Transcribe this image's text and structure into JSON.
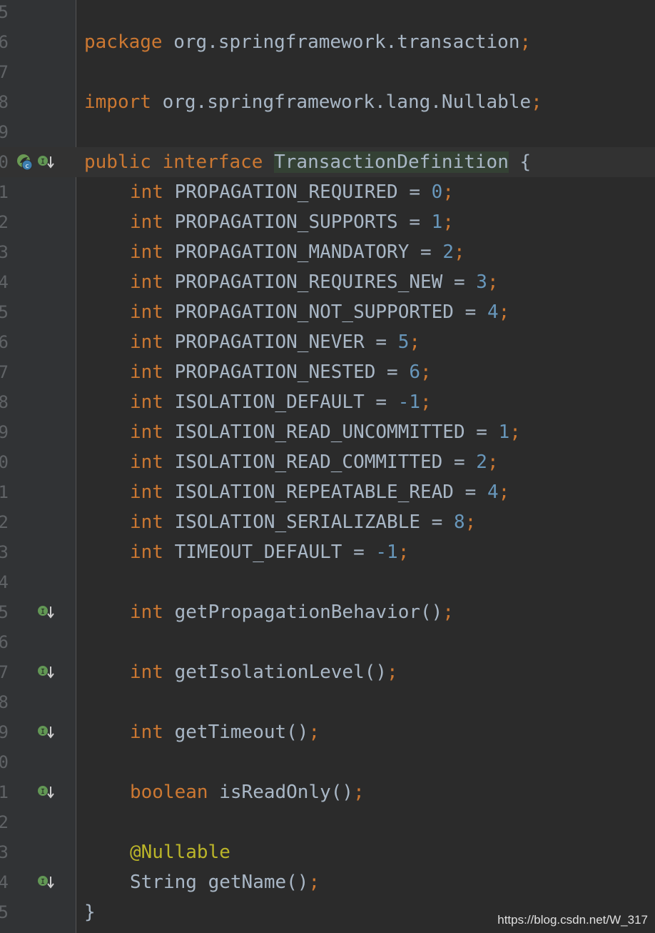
{
  "editor": {
    "gutter_line_numbers": [
      "5",
      "6",
      "7",
      "8",
      "9",
      "0",
      "1",
      "2",
      "3",
      "4",
      "5",
      "6",
      "7",
      "8",
      "9",
      "0",
      "1",
      "2",
      "3",
      "4",
      "5",
      "6",
      "7",
      "8",
      "9",
      "0",
      "1",
      "2",
      "3",
      "4",
      "5"
    ],
    "package_kw": "package",
    "package_name": "org.springframework.transaction",
    "import_kw": "import",
    "import_name": "org.springframework.lang.Nullable",
    "public_kw": "public",
    "interface_kw": "interface",
    "interface_name": "TransactionDefinition",
    "open_brace": "{",
    "close_brace": "}",
    "constants": [
      {
        "type": "int",
        "name": "PROPAGATION_REQUIRED",
        "value": "0"
      },
      {
        "type": "int",
        "name": "PROPAGATION_SUPPORTS",
        "value": "1"
      },
      {
        "type": "int",
        "name": "PROPAGATION_MANDATORY",
        "value": "2"
      },
      {
        "type": "int",
        "name": "PROPAGATION_REQUIRES_NEW",
        "value": "3"
      },
      {
        "type": "int",
        "name": "PROPAGATION_NOT_SUPPORTED",
        "value": "4"
      },
      {
        "type": "int",
        "name": "PROPAGATION_NEVER",
        "value": "5"
      },
      {
        "type": "int",
        "name": "PROPAGATION_NESTED",
        "value": "6"
      },
      {
        "type": "int",
        "name": "ISOLATION_DEFAULT",
        "value": "-1"
      },
      {
        "type": "int",
        "name": "ISOLATION_READ_UNCOMMITTED",
        "value": "1"
      },
      {
        "type": "int",
        "name": "ISOLATION_READ_COMMITTED",
        "value": "2"
      },
      {
        "type": "int",
        "name": "ISOLATION_REPEATABLE_READ",
        "value": "4"
      },
      {
        "type": "int",
        "name": "ISOLATION_SERIALIZABLE",
        "value": "8"
      },
      {
        "type": "int",
        "name": "TIMEOUT_DEFAULT",
        "value": "-1"
      }
    ],
    "methods": [
      {
        "type": "int",
        "name": "getPropagationBehavior();"
      },
      {
        "type": "int",
        "name": "getIsolationLevel();"
      },
      {
        "type": "int",
        "name": "getTimeout();"
      },
      {
        "type": "boolean",
        "name": "isReadOnly();"
      }
    ],
    "annotation": "@Nullable",
    "last_method_type": "String",
    "last_method_name": "getName();",
    "icons": [
      "spring-bean-icon",
      "implemented-by-icon"
    ]
  },
  "watermark": "https://blog.csdn.net/W_317"
}
